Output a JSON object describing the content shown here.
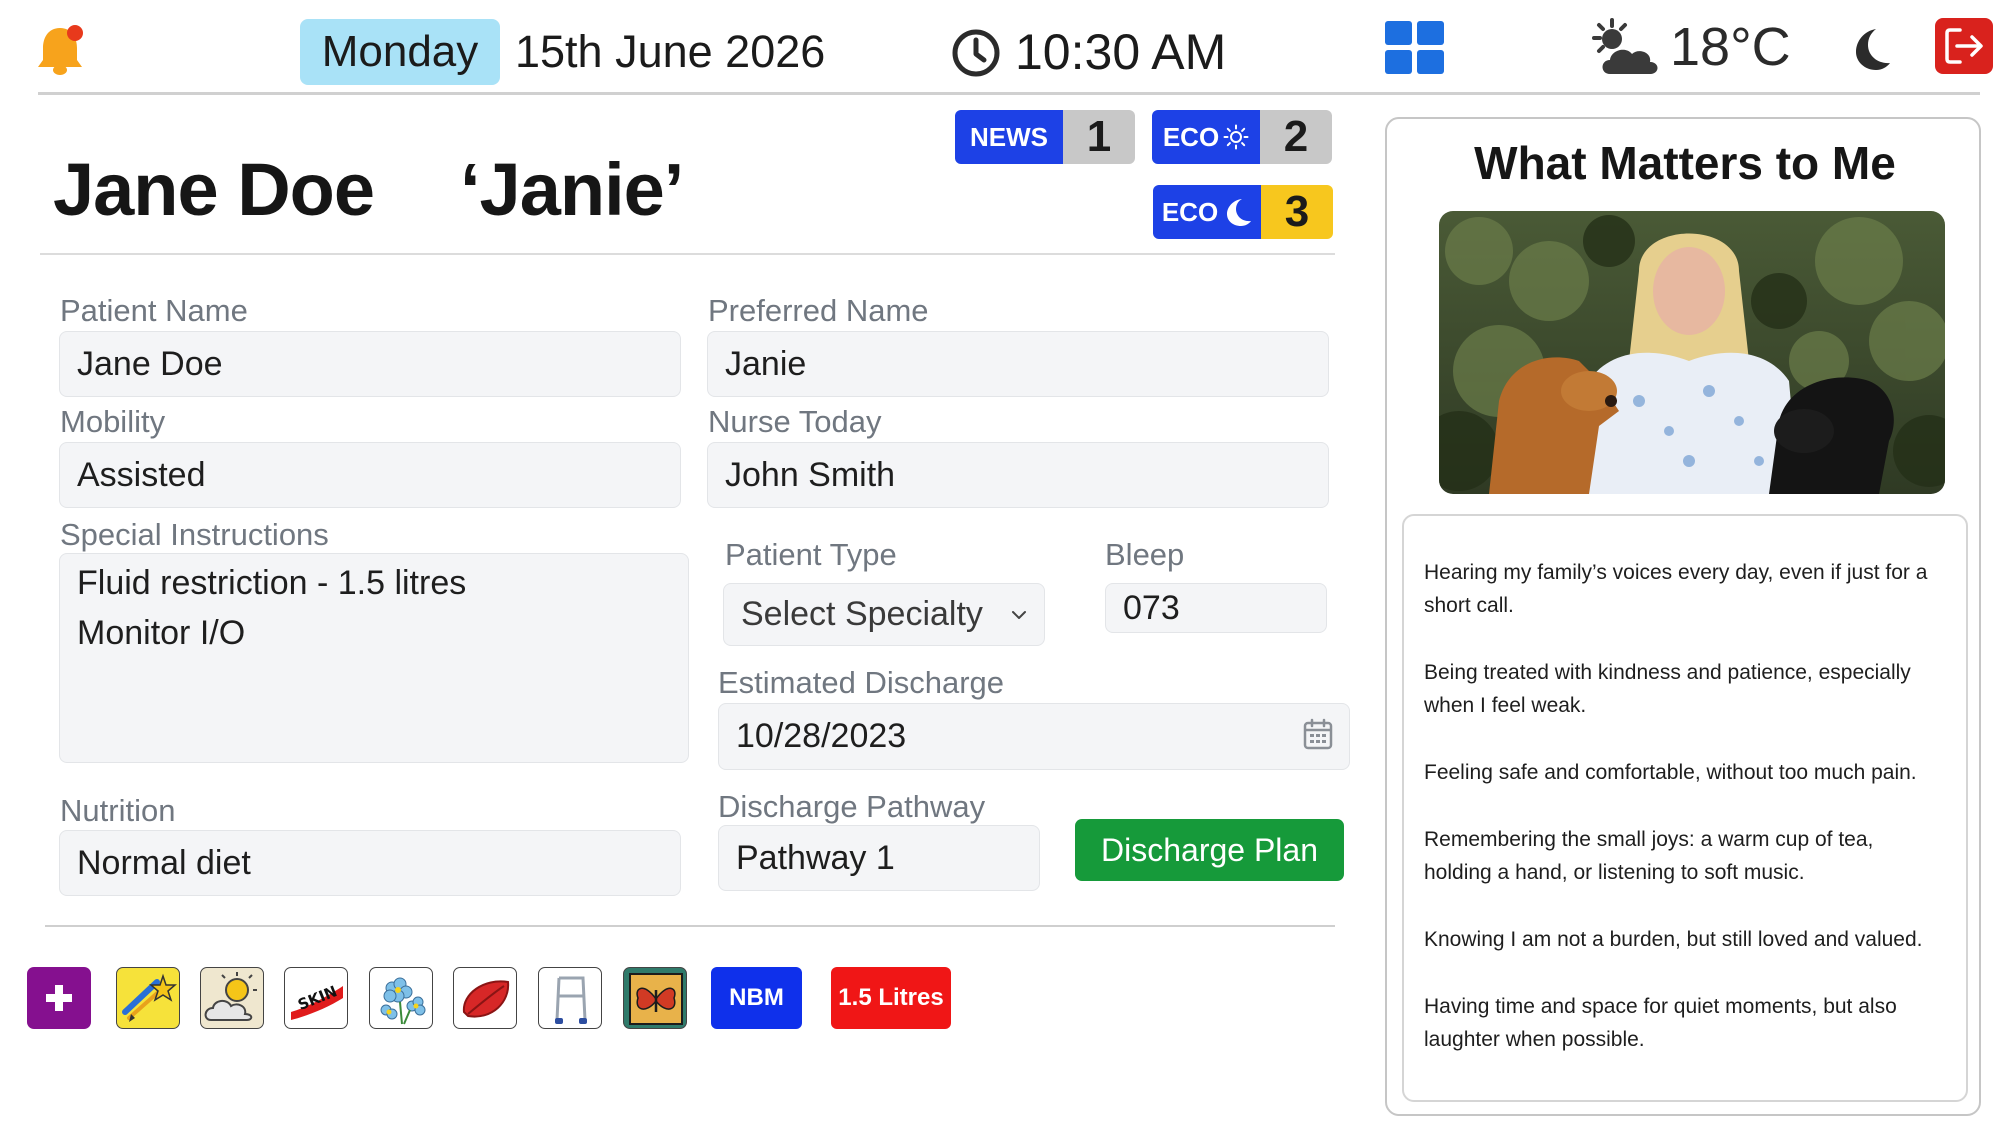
{
  "topbar": {
    "day": "Monday",
    "date": "15th June 2026",
    "time": "10:30 AM",
    "temperature": "18°C",
    "icons": [
      "bell-icon",
      "clock-icon",
      "grid-icon",
      "weather-sun-cloud-icon",
      "moon-icon",
      "logout-icon"
    ]
  },
  "header": {
    "name": "Jane Doe",
    "nickname": "‘Janie’"
  },
  "scores": {
    "news": {
      "label": "NEWS",
      "value": "1"
    },
    "eco_day": {
      "label": "ECO",
      "value": "2"
    },
    "eco_night": {
      "label": "ECO",
      "value": "3"
    }
  },
  "form": {
    "patient_name": {
      "label": "Patient Name",
      "value": "Jane Doe"
    },
    "preferred_name": {
      "label": "Preferred Name",
      "value": "Janie"
    },
    "mobility": {
      "label": "Mobility",
      "value": "Assisted"
    },
    "nurse_today": {
      "label": "Nurse Today",
      "value": "John Smith"
    },
    "special_instructions": {
      "label": "Special Instructions",
      "lines": [
        "Fluid restriction - 1.5 litres",
        "Monitor I/O"
      ]
    },
    "patient_type": {
      "label": "Patient Type",
      "value": "Select Specialty"
    },
    "bleep": {
      "label": "Bleep",
      "value": "073"
    },
    "estimated_discharge": {
      "label": "Estimated Discharge",
      "value": "10/28/2023"
    },
    "nutrition": {
      "label": "Nutrition",
      "value": "Normal diet"
    },
    "discharge_pathway": {
      "label": "Discharge Pathway",
      "value": "Pathway 1"
    },
    "discharge_plan_button": "Discharge Plan"
  },
  "icon_strip": {
    "icons": [
      "add-icon",
      "shooting-star-icon",
      "sun-cloud-icon",
      "skin-icon",
      "forget-me-not-icon",
      "red-leaf-icon",
      "walking-frame-icon",
      "butterfly-icon"
    ],
    "nbm": "NBM",
    "litres": "1.5 Litres"
  },
  "what_matters": {
    "title": "What Matters to Me",
    "items": [
      "Hearing my family’s voices every day, even if just for a short call.",
      "Being treated with kindness and patience, especially when I feel weak.",
      "Feeling safe and comfortable, without too much pain.",
      "Remembering the small joys: a warm cup of tea, holding a hand, or listening to soft music.",
      "Knowing I am not a burden, but still loved and valued.",
      "Having time and space for quiet moments, but also laughter when possible."
    ]
  },
  "colors": {
    "day_pill": "#a9e2f7",
    "score_blue": "#1d41e6",
    "score_grey": "#c8c8c8",
    "score_yellow": "#f7c71e",
    "discharge_green": "#169a3a",
    "logout_red": "#d9221d",
    "add_purple": "#85108f",
    "nbm_blue": "#0f30eb",
    "litres_red": "#f01616"
  }
}
